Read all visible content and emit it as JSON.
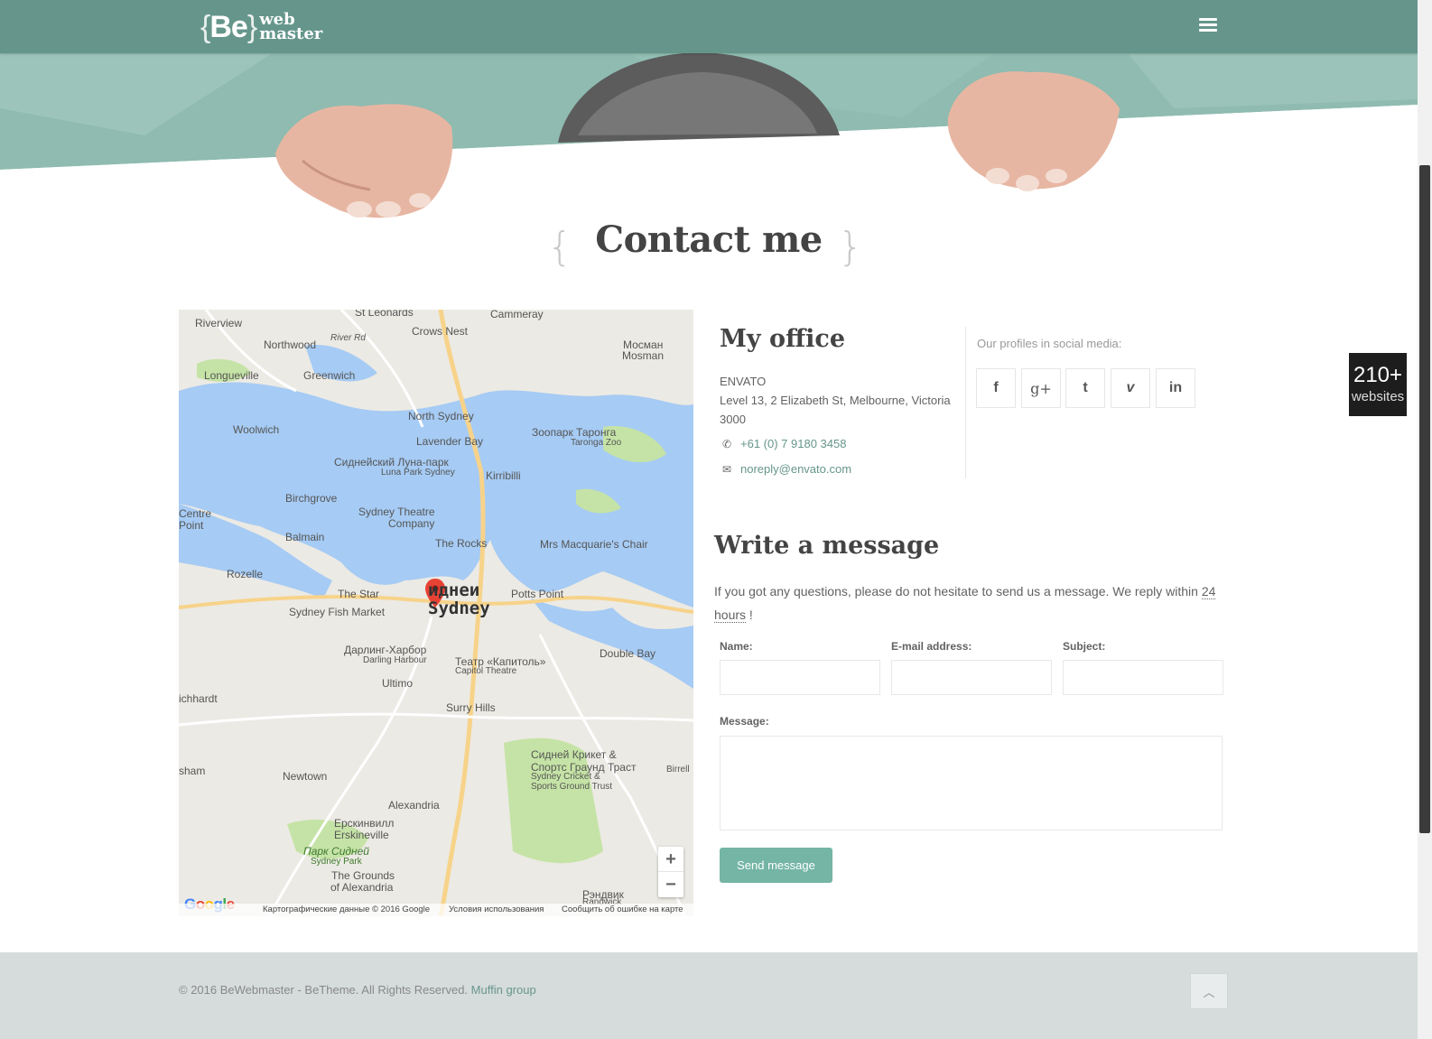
{
  "brand": {
    "be": "Be",
    "word1": "web",
    "word2": "master"
  },
  "section": {
    "title": "Contact me",
    "brace_open": "{",
    "brace_close": "}"
  },
  "map": {
    "labels": [
      {
        "text": "Riverview"
      },
      {
        "text": "St Leonards"
      },
      {
        "text": "Cammeray"
      },
      {
        "text": "Northwood"
      },
      {
        "text": "River Rd"
      },
      {
        "text": "Crows Nest"
      },
      {
        "text": "Мосман"
      },
      {
        "text": "Mosman"
      },
      {
        "text": "Longueville"
      },
      {
        "text": "Greenwich"
      },
      {
        "text": "Woolwich"
      },
      {
        "text": "North Sydney"
      },
      {
        "text": "Lavender Bay"
      },
      {
        "text": "Зоопарк Таронга"
      },
      {
        "text": "Taronga Zoo"
      },
      {
        "text": "Сиднейский Луна-парк"
      },
      {
        "text": "Luna Park Sydney"
      },
      {
        "text": "Kirribilli"
      },
      {
        "text": "Birchgrove"
      },
      {
        "text": "Sydney Theatre"
      },
      {
        "text": "Company"
      },
      {
        "text": "Balmain"
      },
      {
        "text": "The Rocks"
      },
      {
        "text": "Mrs Macquarie's Chair"
      },
      {
        "text": "Rozelle"
      },
      {
        "text": "The Star"
      },
      {
        "text": "Potts Point"
      },
      {
        "text": "Sydney Fish Market"
      },
      {
        "text": "Дарлинг-Харбор"
      },
      {
        "text": "Darling Harbour"
      },
      {
        "text": "Театр «Капитоль»"
      },
      {
        "text": "Capitol Theatre"
      },
      {
        "text": "Double Bay"
      },
      {
        "text": "Ultimo"
      },
      {
        "text": "ichhardt"
      },
      {
        "text": "Surry Hills"
      },
      {
        "text": "Сидней Крикет &"
      },
      {
        "text": "Спортс Граунд Траст"
      },
      {
        "text": "Sydney Cricket &"
      },
      {
        "text": "Sports Ground Trust"
      },
      {
        "text": "Newtown"
      },
      {
        "text": "Alexandria"
      },
      {
        "text": "Ерскинвилл"
      },
      {
        "text": "Erskineville"
      },
      {
        "text": "Парк Сидней"
      },
      {
        "text": "Sydney Park"
      },
      {
        "text": "The Grounds"
      },
      {
        "text": "of Alexandria"
      },
      {
        "text": "Рэндвик"
      },
      {
        "text": "Randwick"
      },
      {
        "text": "Birrell"
      },
      {
        "text": "sham"
      },
      {
        "text": "Centre"
      },
      {
        "text": "Point"
      }
    ],
    "city_ru": "иднеи",
    "city_en": "Sydney",
    "zoom_in": "+",
    "zoom_out": "−",
    "google": "Google",
    "footer": {
      "data": "Картографические данные © 2016 Google",
      "terms": "Условия использования",
      "report": "Сообщить об ошибке на карте"
    }
  },
  "office": {
    "heading": "My office",
    "company": "ENVATO",
    "address1": "Level 13, 2 Elizabeth St, Melbourne, Victoria",
    "address2": "3000",
    "phone": "+61 (0) 7 9180 3458",
    "email": "noreply@envato.com"
  },
  "social": {
    "heading": "Our profiles in social media:",
    "items": [
      {
        "icon": "facebook-icon",
        "glyph": "f"
      },
      {
        "icon": "google-plus-icon",
        "glyph": "g+"
      },
      {
        "icon": "twitter-icon",
        "glyph": "t"
      },
      {
        "icon": "vimeo-icon",
        "glyph": "v"
      },
      {
        "icon": "linkedin-icon",
        "glyph": "in"
      }
    ]
  },
  "badge": {
    "number": "210+",
    "label": "websites"
  },
  "form": {
    "heading": "Write a message",
    "intro_before": "If you got any questions, please do not hesitate to send us a message. We reply within ",
    "intro_highlight": "24 hours",
    "intro_after": " !",
    "name_label": "Name:",
    "email_label": "E-mail address:",
    "subject_label": "Subject:",
    "message_label": "Message:",
    "name_value": "",
    "email_value": "",
    "subject_value": "",
    "message_value": "",
    "submit_label": "Send message"
  },
  "footer": {
    "copyright": "© 2016 BeWebmaster - BeTheme. All Rights Reserved.",
    "link": "Muffin group"
  },
  "colors": {
    "accent": "#66968b",
    "button": "#74b5a5",
    "hero": "#8bb8ad",
    "footer_bg": "#d6dcdb",
    "water": "#a6cbf4",
    "park": "#c5e3a6"
  }
}
